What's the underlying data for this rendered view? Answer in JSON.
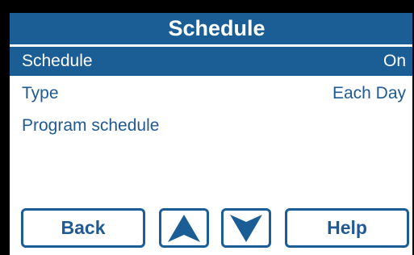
{
  "header": {
    "title": "Schedule"
  },
  "menu": {
    "items": [
      {
        "label": "Schedule",
        "value": "On",
        "selected": true
      },
      {
        "label": "Type",
        "value": "Each Day",
        "selected": false
      },
      {
        "label": "Program schedule",
        "value": "",
        "selected": false
      }
    ]
  },
  "footer": {
    "back_label": "Back",
    "up_icon": "arrow-up-icon",
    "down_icon": "arrow-down-icon",
    "help_label": "Help"
  },
  "colors": {
    "accent": "#1b5e96",
    "text": "#1f5a92",
    "background": "#ffffff",
    "bezel": "#000000"
  }
}
